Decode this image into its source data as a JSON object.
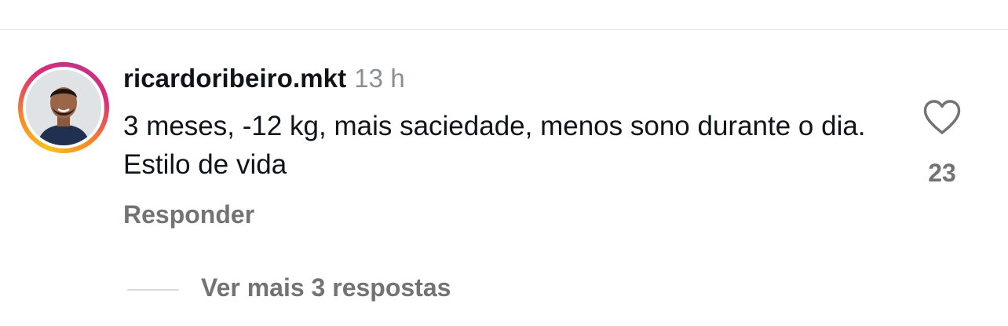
{
  "comment": {
    "username": "ricardoribeiro.mkt",
    "timestamp": "13 h",
    "text": "3 meses, -12 kg, mais saciedade, menos sono durante o dia. Estilo de vida",
    "reply_label": "Responder",
    "like_count": "23",
    "view_replies_label": "Ver mais 3 respostas"
  },
  "icons": {
    "like": "heart-outline-icon"
  },
  "colors": {
    "primary_text": "#0f1419",
    "secondary_text": "#737373",
    "timestamp_text": "#8a8f94",
    "story_ring": [
      "#f9c11c",
      "#f58529",
      "#dd2a7b",
      "#c13584"
    ]
  }
}
